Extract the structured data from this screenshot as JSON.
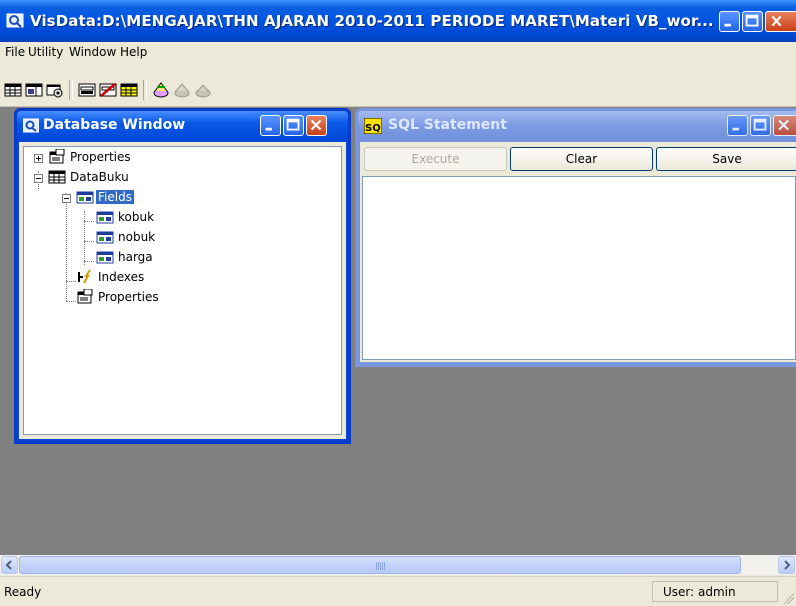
{
  "app": {
    "title": "VisData:D:\\MENGAJAR\\THN AJARAN 2010-2011 PERIODE MARET\\Materi VB_wor..."
  },
  "menu": [
    {
      "label": "File"
    },
    {
      "label": "Utility"
    },
    {
      "label": "Window"
    },
    {
      "label": "Help"
    }
  ],
  "toolbar": {
    "icons": [
      "table-type-icon",
      "dynaset-type-icon",
      "snapshot-type-icon",
      "data-control-icon",
      "no-data-control-icon",
      "dbgrid-control-icon",
      "begin-transaction-icon",
      "commit-icon",
      "rollback-icon"
    ]
  },
  "database_window": {
    "title": "Database Window",
    "tree": [
      {
        "label": "Properties",
        "level": 0,
        "icon": "properties-icon",
        "expander": "plus"
      },
      {
        "label": "DataBuku",
        "level": 0,
        "icon": "table-icon",
        "expander": "minus"
      },
      {
        "label": "Fields",
        "level": 1,
        "icon": "fields-icon",
        "expander": "minus",
        "selected": true
      },
      {
        "label": "kobuk",
        "level": 2,
        "icon": "field-icon"
      },
      {
        "label": "nobuk",
        "level": 2,
        "icon": "field-icon"
      },
      {
        "label": "harga",
        "level": 2,
        "icon": "field-icon"
      },
      {
        "label": "Indexes",
        "level": 1,
        "icon": "indexes-icon"
      },
      {
        "label": "Properties",
        "level": 1,
        "icon": "properties-icon"
      }
    ]
  },
  "sql_window": {
    "title": "SQL Statement",
    "buttons": {
      "execute": "Execute",
      "clear": "Clear",
      "save": "Save"
    },
    "text": ""
  },
  "statusbar": {
    "status": "Ready",
    "user": "User: admin"
  },
  "colors": {
    "titlebar": "#0054e3",
    "inactive_titlebar": "#7a96df",
    "mdi_background": "#808080",
    "selection": "#316ac5"
  }
}
